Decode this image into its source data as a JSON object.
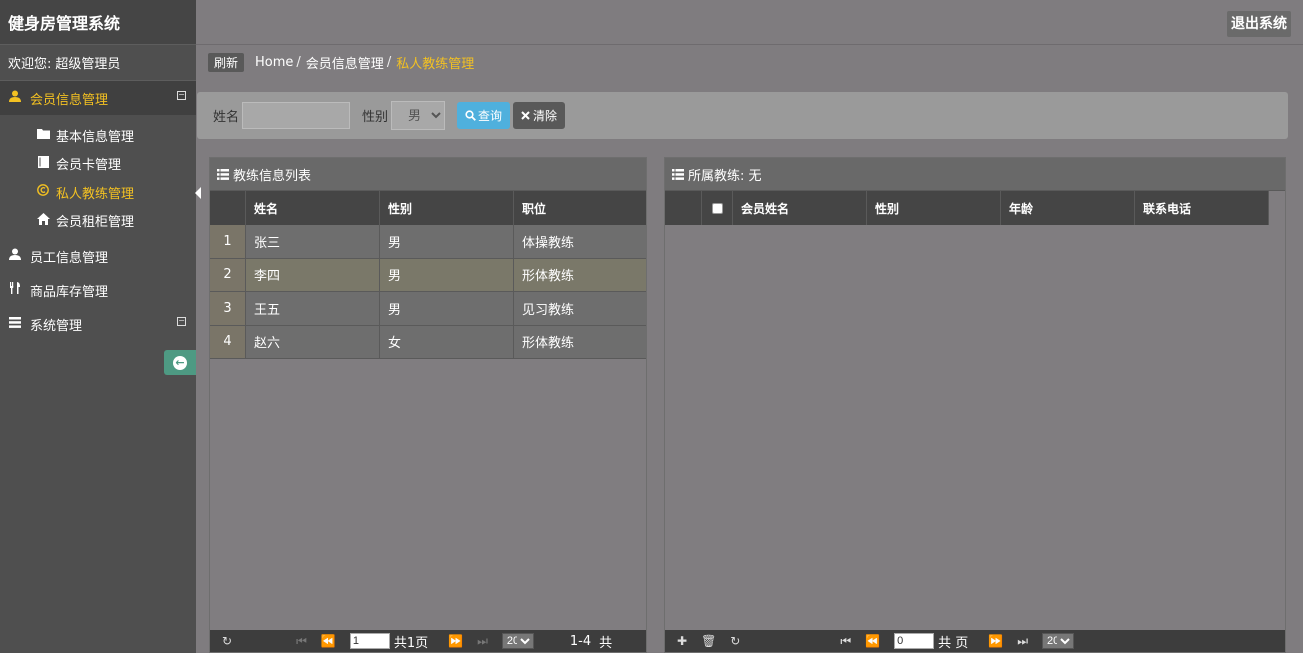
{
  "app": {
    "title": "健身房管理系统",
    "logout": "退出系统"
  },
  "welcome": {
    "label": "欢迎您:",
    "user": "超级管理员"
  },
  "sidebar": {
    "groups": [
      {
        "label": "会员信息管理",
        "icon": "user-icon",
        "active": true,
        "items": [
          {
            "label": "基本信息管理",
            "icon": "folder-icon"
          },
          {
            "label": "会员卡管理",
            "icon": "book-icon"
          },
          {
            "label": "私人教练管理",
            "icon": "copyright-icon",
            "active": true
          },
          {
            "label": "会员租柜管理",
            "icon": "home-icon"
          }
        ]
      },
      {
        "label": "员工信息管理",
        "icon": "user-icon"
      },
      {
        "label": "商品库存管理",
        "icon": "cutlery-icon"
      },
      {
        "label": "系统管理",
        "icon": "list-icon"
      }
    ]
  },
  "breadcrumb": {
    "refresh": "刷新",
    "home": "Home",
    "parent": "会员信息管理",
    "current": "私人教练管理"
  },
  "search": {
    "name_label": "姓名",
    "name_value": "",
    "gender_label": "性别",
    "gender_value": "男",
    "query": "查询",
    "clear": "清除"
  },
  "left_panel": {
    "title": "教练信息列表",
    "columns": [
      "姓名",
      "性别",
      "职位"
    ],
    "rows": [
      {
        "n": "1",
        "name": "张三",
        "gender": "男",
        "position": "体操教练"
      },
      {
        "n": "2",
        "name": "李四",
        "gender": "男",
        "position": "形体教练"
      },
      {
        "n": "3",
        "name": "王五",
        "gender": "男",
        "position": "见习教练"
      },
      {
        "n": "4",
        "name": "赵六",
        "gender": "女",
        "position": "形体教练"
      }
    ],
    "pager": {
      "page": "1",
      "total": "共1页",
      "size": "20",
      "range": "1-4",
      "count": "共"
    }
  },
  "right_panel": {
    "title": "所属教练: 无",
    "columns": [
      "会员姓名",
      "性别",
      "年龄",
      "联系电话"
    ],
    "pager": {
      "page": "0",
      "total": "共 页",
      "size": "20"
    }
  },
  "colors": {
    "accent": "#f3c122",
    "query_btn": "#4fb0dd",
    "collapse_btn": "#4e9a83"
  }
}
